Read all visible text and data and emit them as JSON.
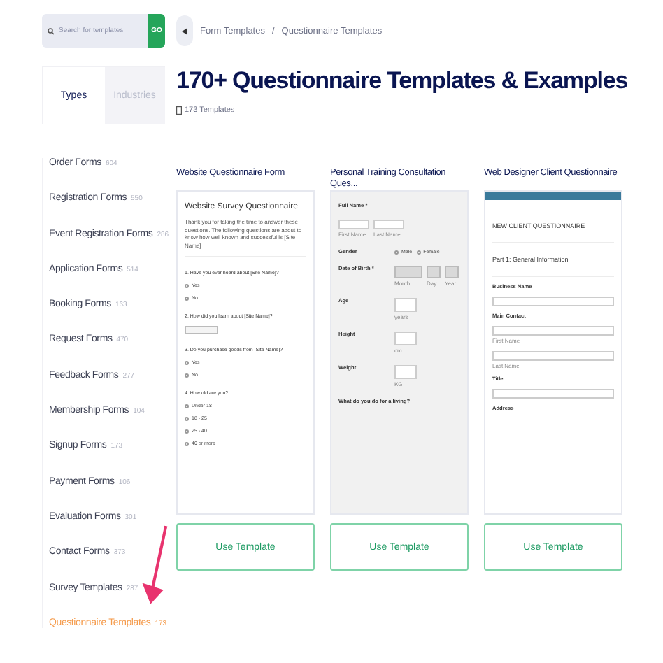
{
  "search": {
    "placeholder": "Search for templates",
    "button": "GO"
  },
  "breadcrumb": [
    "Form Templates",
    "Questionnaire Templates"
  ],
  "breadcrumb_separator": "/",
  "title": "170+ Questionnaire Templates & Examples",
  "count": "173 Templates",
  "tabs": [
    {
      "label": "Types",
      "selected": true
    },
    {
      "label": "Industries",
      "selected": false
    }
  ],
  "categories": [
    {
      "name": "Order Forms",
      "count": "604",
      "selected": false
    },
    {
      "name": "Registration Forms",
      "count": "550",
      "selected": false
    },
    {
      "name": "Event Registration Forms",
      "count": "286",
      "selected": false
    },
    {
      "name": "Application Forms",
      "count": "514",
      "selected": false
    },
    {
      "name": "Booking Forms",
      "count": "163",
      "selected": false
    },
    {
      "name": "Request Forms",
      "count": "470",
      "selected": false
    },
    {
      "name": "Feedback Forms",
      "count": "277",
      "selected": false
    },
    {
      "name": "Membership Forms",
      "count": "104",
      "selected": false
    },
    {
      "name": "Signup Forms",
      "count": "173",
      "selected": false
    },
    {
      "name": "Payment Forms",
      "count": "106",
      "selected": false
    },
    {
      "name": "Evaluation Forms",
      "count": "301",
      "selected": false
    },
    {
      "name": "Contact Forms",
      "count": "373",
      "selected": false
    },
    {
      "name": "Survey Templates",
      "count": "287",
      "selected": false
    },
    {
      "name": "Questionnaire Templates",
      "count": "173",
      "selected": true
    }
  ],
  "cards": [
    {
      "title": "Website Questionnaire Form",
      "button": "Use Template",
      "preview": {
        "kind": "survey",
        "items": [
          {
            "kind": "heading",
            "text": "Website Survey Questionnaire"
          },
          {
            "kind": "text",
            "text": "Thank you for taking the time to answer these questions. The following questions are about to know how well known and successful is [Site Name]"
          },
          {
            "kind": "rule"
          },
          {
            "kind": "question",
            "text": "1. Have you ever heard about [Site Name]?"
          },
          {
            "kind": "option",
            "text": "Yes",
            "checked": false
          },
          {
            "kind": "option",
            "text": "No",
            "checked": false
          },
          {
            "kind": "question",
            "text": "2. How did you learn about [Site Name]?"
          },
          {
            "kind": "select"
          },
          {
            "kind": "question",
            "text": "3. Do you purchase goods from [Site Name]?"
          },
          {
            "kind": "option",
            "text": "Yes",
            "checked": false
          },
          {
            "kind": "option",
            "text": "No",
            "checked": false
          },
          {
            "kind": "question",
            "text": "4. How old are you?"
          },
          {
            "kind": "option",
            "text": "Under 18",
            "checked": false
          },
          {
            "kind": "option",
            "text": "18 - 25",
            "checked": false
          },
          {
            "kind": "option",
            "text": "25 - 40",
            "checked": false
          },
          {
            "kind": "option",
            "text": "40 or more",
            "checked": false
          }
        ]
      }
    },
    {
      "title": "Personal Training Consultation Ques...",
      "button": "Use Template",
      "preview": {
        "kind": "profile",
        "items": [
          {
            "kind": "label",
            "text": "Full Name *"
          },
          {
            "kind": "pair",
            "parts": [
              "First Name",
              "Last Name"
            ]
          },
          {
            "kind": "radio-row",
            "text": "Gender",
            "options": [
              {
                "text": "Male",
                "checked": false
              },
              {
                "text": "Female",
                "checked": false
              }
            ]
          },
          {
            "kind": "date-row",
            "text": "Date of Birth *",
            "parts": [
              "Month",
              "Day",
              "Year"
            ]
          },
          {
            "kind": "input-row",
            "text": "Age",
            "unit": "years"
          },
          {
            "kind": "input-row",
            "text": "Height",
            "unit": "cm"
          },
          {
            "kind": "input-row",
            "text": "Weight",
            "unit": "KG"
          },
          {
            "kind": "label",
            "text": "What do you do for a living?"
          }
        ]
      }
    },
    {
      "title": "Web Designer Client Questionnaire",
      "button": "Use Template",
      "preview": {
        "kind": "intake",
        "items": [
          {
            "kind": "heading",
            "text": "NEW CLIENT QUESTIONNAIRE"
          },
          {
            "kind": "rule"
          },
          {
            "kind": "heading",
            "text": "Part 1: General Information"
          },
          {
            "kind": "rule"
          },
          {
            "kind": "label",
            "text": "Business Name"
          },
          {
            "kind": "input"
          },
          {
            "kind": "label",
            "text": "Main Contact"
          },
          {
            "kind": "input",
            "sub": "First Name"
          },
          {
            "kind": "input",
            "sub": "Last Name"
          },
          {
            "kind": "label",
            "text": "Title"
          },
          {
            "kind": "input"
          },
          {
            "kind": "label",
            "text": "Address"
          }
        ]
      }
    }
  ]
}
